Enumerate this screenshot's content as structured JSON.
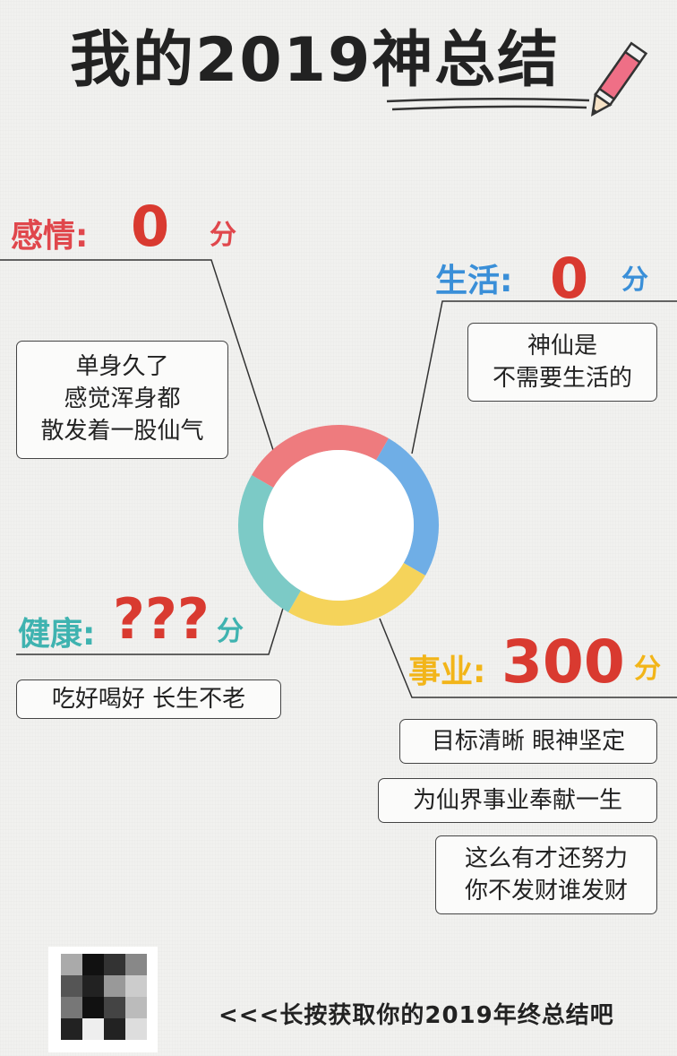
{
  "title": "我的2019神总结",
  "categories": [
    {
      "key": "emotion",
      "label": "感情:",
      "score": "0",
      "unit": "分",
      "color": "#e0474c",
      "text": [
        "单身久了",
        "感觉浑身都",
        "散发着一股仙气"
      ]
    },
    {
      "key": "life",
      "label": "生活:",
      "score": "0",
      "unit": "分",
      "color": "#3a8fd8",
      "text": [
        "神仙是",
        "不需要生活的"
      ]
    },
    {
      "key": "health",
      "label": "健康:",
      "score": "???",
      "unit": "分",
      "color": "#3fb3b0",
      "text": [
        "吃好喝好 长生不老"
      ]
    },
    {
      "key": "career",
      "label": "事业:",
      "score": "300",
      "unit": "分",
      "color": "#f2b519",
      "text": [
        "目标清晰 眼神坚定",
        "为仙界事业奉献一生",
        "这么有才还努力",
        "你不发财谁发财"
      ]
    }
  ],
  "career_score_color": "#d93a30",
  "ring_colors": [
    "#ee7b7e",
    "#6faee6",
    "#f5d35a",
    "#7ccac6"
  ],
  "footer": "<<<长按获取你的2019年终总结吧"
}
